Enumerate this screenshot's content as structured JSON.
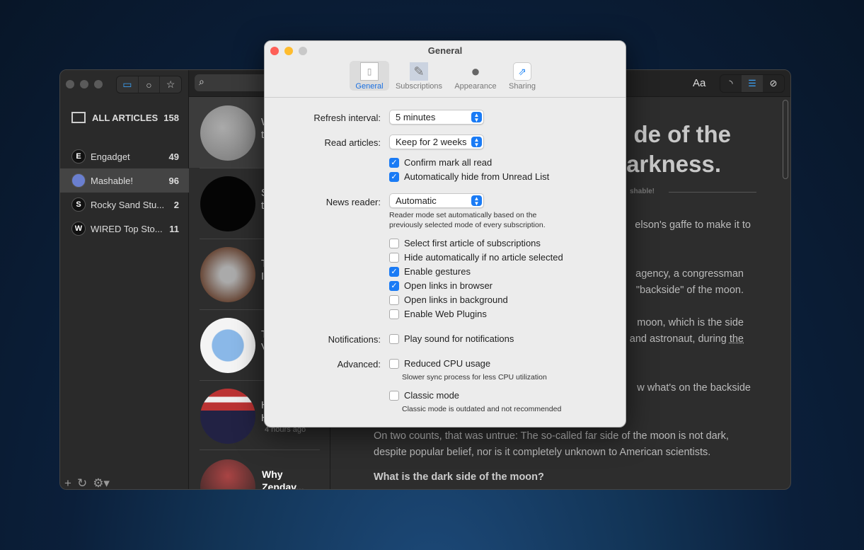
{
  "sidebar": {
    "all_label": "ALL ARTICLES",
    "all_count": "158",
    "feeds": [
      {
        "name": "Engadget",
        "count": "49",
        "icon": "E"
      },
      {
        "name": "Mashable!",
        "count": "96",
        "icon": "🌐"
      },
      {
        "name": "Rocky Sand Stu...",
        "count": "2",
        "icon": "S"
      },
      {
        "name": "WIRED Top Sto...",
        "count": "11",
        "icon": "W"
      }
    ]
  },
  "list": {
    "time": "4 hours ago",
    "last_title": "Why Zendav...",
    "fragments": [
      "W",
      "t",
      "S",
      "t",
      "T",
      "I",
      "T",
      "V",
      "H",
      "H"
    ]
  },
  "toolbar": {
    "font_label": "Aa"
  },
  "article": {
    "title1": "de of the",
    "title2": "arkness.",
    "byline": "shable!",
    "p1": "elson's gaffe to make it to",
    "p2a": "agency, a congressman",
    "p2b": "\"backside\" of the moon.",
    "p3a": "moon, which is the side",
    "p3b": "and astronaut, during",
    "p3link": "the",
    "p4": "w what's on the backside",
    "p5a": "On two counts, that was untrue: The so-called far side of the moon is not dark,",
    "p5b": "despite popular belief, nor is it completely unknown to American scientists.",
    "h2": "What is the dark side of the moon?"
  },
  "prefs": {
    "title": "General",
    "tabs": [
      "General",
      "Subscriptions",
      "Appearance",
      "Sharing"
    ],
    "refresh_label": "Refresh interval:",
    "refresh_value": "5 minutes",
    "read_label": "Read articles:",
    "read_value": "Keep for 2 weeks",
    "confirm": "Confirm mark all read",
    "autohide": "Automatically hide from Unread List",
    "reader_label": "News reader:",
    "reader_value": "Automatic",
    "reader_note1": "Reader mode set automatically based on the",
    "reader_note2": "previously selected mode of every subscription.",
    "opts": [
      {
        "label": "Select first article of subscriptions",
        "checked": false
      },
      {
        "label": "Hide automatically if no article selected",
        "checked": false
      },
      {
        "label": "Enable gestures",
        "checked": true
      },
      {
        "label": "Open links in browser",
        "checked": true
      },
      {
        "label": "Open links in background",
        "checked": false
      },
      {
        "label": "Enable Web Plugins",
        "checked": false
      }
    ],
    "notif_label": "Notifications:",
    "notif_opt": "Play sound for notifications",
    "adv_label": "Advanced:",
    "cpu_opt": "Reduced CPU usage",
    "cpu_note": "Slower sync process for less CPU utilization",
    "classic_opt": "Classic mode",
    "classic_note": "Classic mode is outdated and not recommended"
  },
  "colors": {
    "accent": "#1a7bf5"
  }
}
